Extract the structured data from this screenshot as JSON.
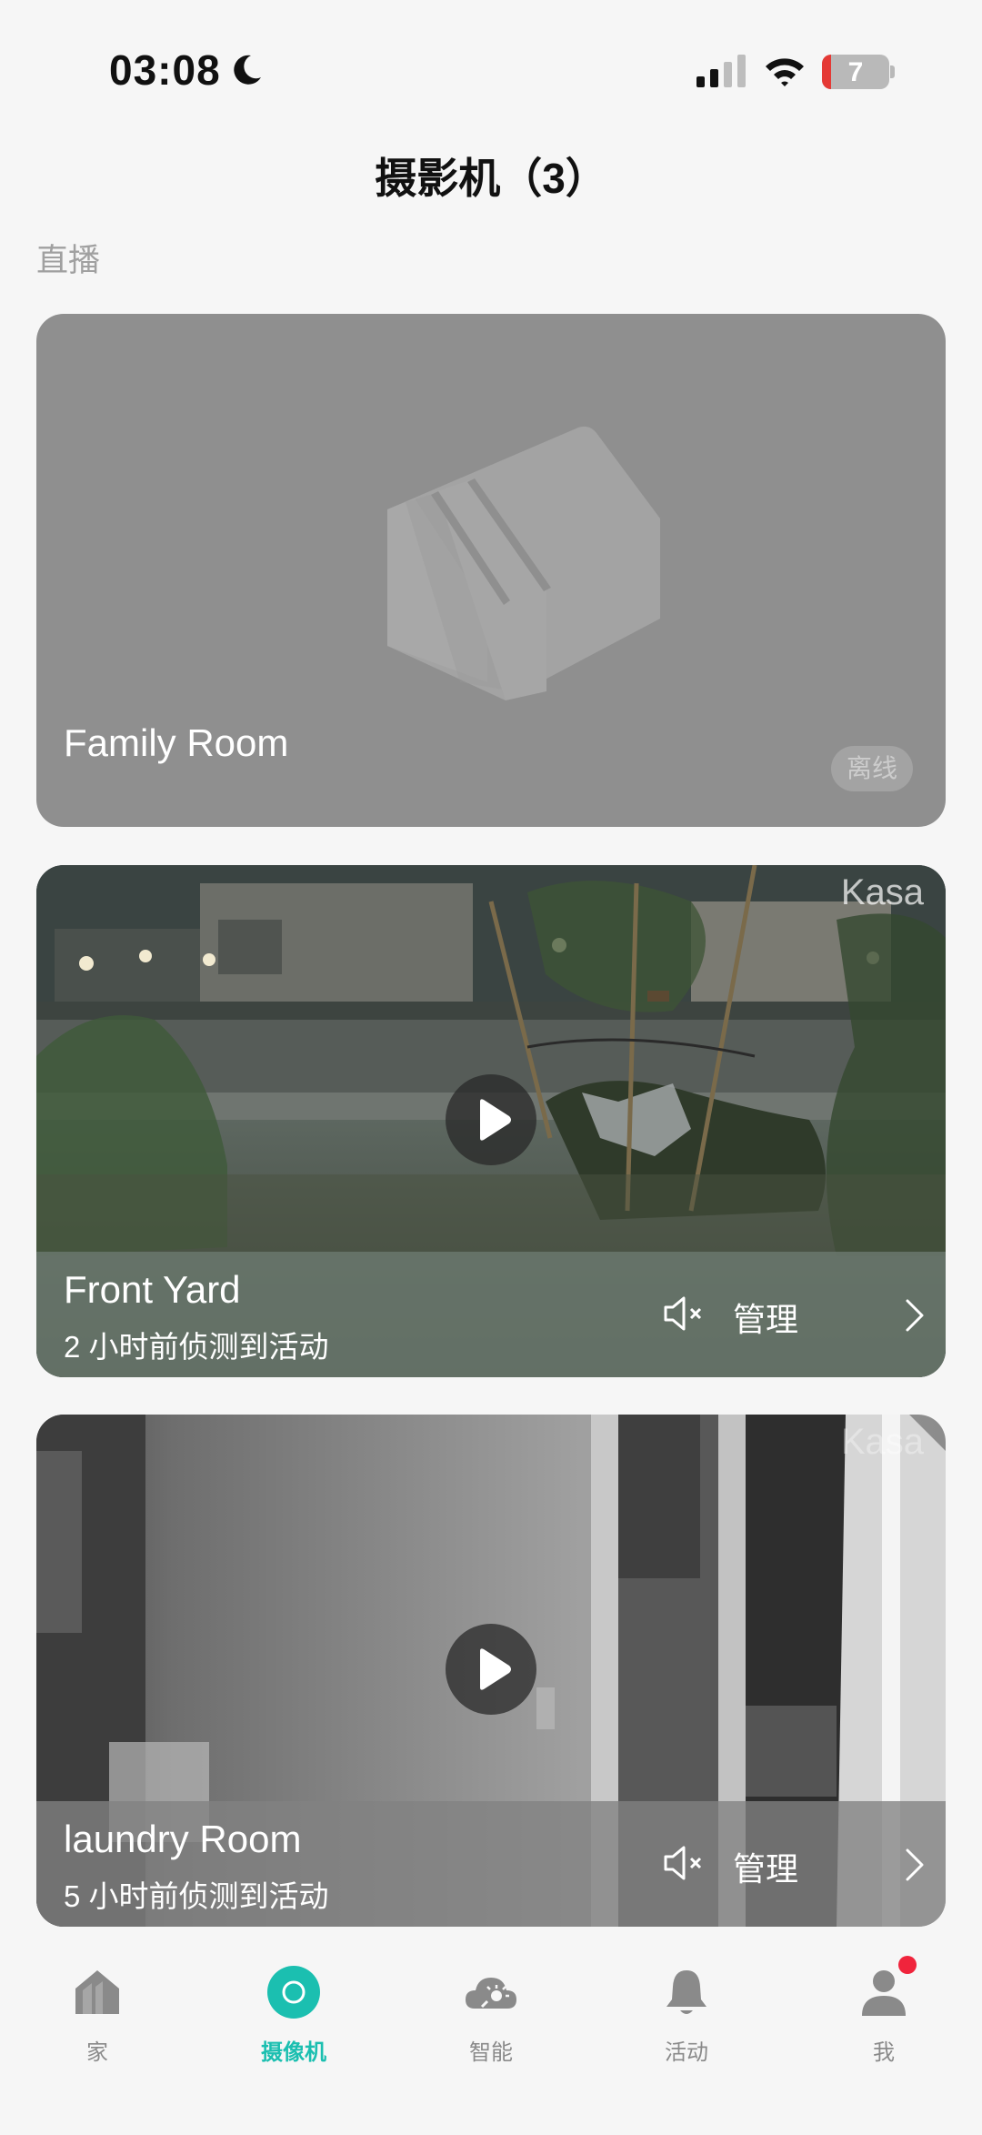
{
  "status_bar": {
    "time": "03:08",
    "battery": "7"
  },
  "header": {
    "title": "摄影机（3）",
    "section": "直播"
  },
  "cameras": [
    {
      "name": "Family Room",
      "status": "离线"
    },
    {
      "name": "Front Yard",
      "activity": "2 小时前侦测到活动",
      "manage": "管理",
      "watermark": "Kasa"
    },
    {
      "name": "laundry Room",
      "activity": "5 小时前侦测到活动",
      "manage": "管理",
      "watermark": "Kasa"
    }
  ],
  "nav": [
    {
      "label": "家",
      "icon": "home-icon"
    },
    {
      "label": "摄像机",
      "icon": "camera-icon",
      "active": true
    },
    {
      "label": "智能",
      "icon": "smart-cloud-icon"
    },
    {
      "label": "活动",
      "icon": "bell-icon"
    },
    {
      "label": "我",
      "icon": "profile-icon",
      "badge": true
    }
  ],
  "colors": {
    "accent": "#1bbfb0",
    "badge": "#f0243c",
    "battery_low": "#e53935"
  }
}
